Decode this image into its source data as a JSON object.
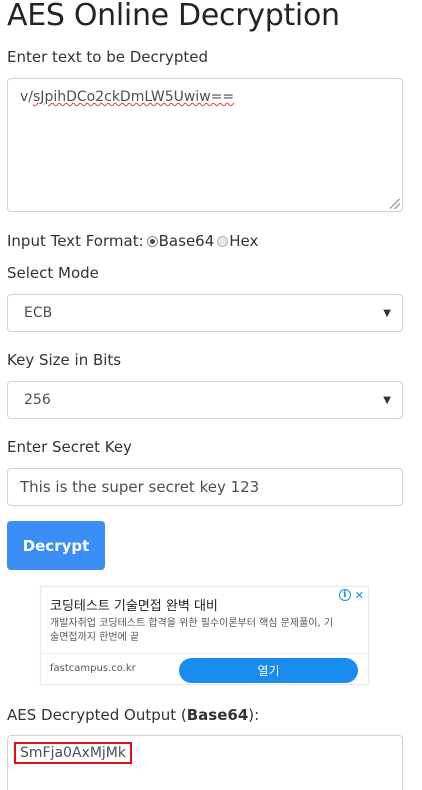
{
  "page": {
    "title": "AES Online Decryption"
  },
  "input_text": {
    "label": "Enter text to be Decrypted",
    "value_prefix": "v/",
    "value_rest": "sJpihDCo2ckDmLW5Uwiw=="
  },
  "format": {
    "label": "Input Text Format:",
    "options": [
      {
        "label": "Base64",
        "checked": true
      },
      {
        "label": "Hex",
        "checked": false
      }
    ]
  },
  "mode": {
    "label": "Select Mode",
    "selected": "ECB"
  },
  "key_size": {
    "label": "Key Size in Bits",
    "selected": "256"
  },
  "secret_key": {
    "label": "Enter Secret Key",
    "value": "This is the super secret key 123"
  },
  "decrypt_button": {
    "label": "Decrypt",
    "color": "#3a8ef6"
  },
  "ad": {
    "title": "코딩테스트 기술면접 완벽 대비",
    "description": "개발자취업 코딩테스트 합격을 위한 필수이론부터 핵심 문제풀이, 기술면접까지 한번에 끝",
    "domain": "fastcampus.co.kr",
    "cta": "열기",
    "info_icon": "info-icon",
    "close_icon": "close-icon"
  },
  "output": {
    "label_prefix": "AES Decrypted Output (",
    "label_format": "Base64",
    "label_suffix": "):",
    "value": "SmFja0AxMjMk",
    "highlight_color": "#e30d16"
  }
}
